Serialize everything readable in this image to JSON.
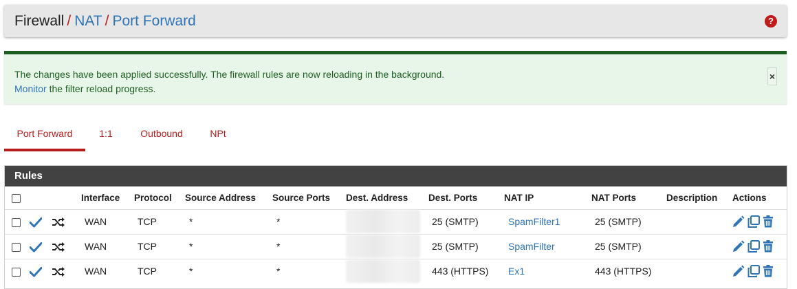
{
  "breadcrumb": {
    "items": [
      "Firewall",
      "NAT",
      "Port Forward"
    ],
    "separator": "/"
  },
  "alert": {
    "message": "The changes have been applied successfully. The firewall rules are now reloading in the background.",
    "monitor_link": "Monitor",
    "monitor_suffix": " the filter reload progress.",
    "close_label": "×"
  },
  "tabs": [
    {
      "label": "Port Forward",
      "active": true
    },
    {
      "label": "1:1",
      "active": false
    },
    {
      "label": "Outbound",
      "active": false
    },
    {
      "label": "NPt",
      "active": false
    }
  ],
  "rules": {
    "title": "Rules",
    "columns": [
      "",
      "",
      "",
      "Interface",
      "Protocol",
      "Source Address",
      "Source Ports",
      "Dest. Address",
      "Dest. Ports",
      "NAT IP",
      "NAT Ports",
      "Description",
      "Actions"
    ],
    "rows": [
      {
        "interface": "WAN",
        "protocol": "TCP",
        "source_address": "*",
        "source_ports": "*",
        "dest_ports": "25 (SMTP)",
        "nat_ip": "SpamFilter1",
        "nat_ports": "25 (SMTP)",
        "description": ""
      },
      {
        "interface": "WAN",
        "protocol": "TCP",
        "source_address": "*",
        "source_ports": "*",
        "dest_ports": "25 (SMTP)",
        "nat_ip": "SpamFilter",
        "nat_ports": "25 (SMTP)",
        "description": ""
      },
      {
        "interface": "WAN",
        "protocol": "TCP",
        "source_address": "*",
        "source_ports": "*",
        "dest_ports": "443 (HTTPS)",
        "nat_ip": "Ex1",
        "nat_ports": "443 (HTTPS)",
        "description": ""
      }
    ]
  },
  "icons": {
    "help": "question-circle-icon",
    "enabled": "check-icon",
    "nat_reflection": "shuffle-icon",
    "edit": "pencil-icon",
    "copy": "copy-icon",
    "delete": "trash-icon"
  },
  "colors": {
    "accent_red": "#b71c1c",
    "link_blue": "#2f74b5",
    "success_green": "#1b5e20",
    "panel_heading": "#424242"
  }
}
